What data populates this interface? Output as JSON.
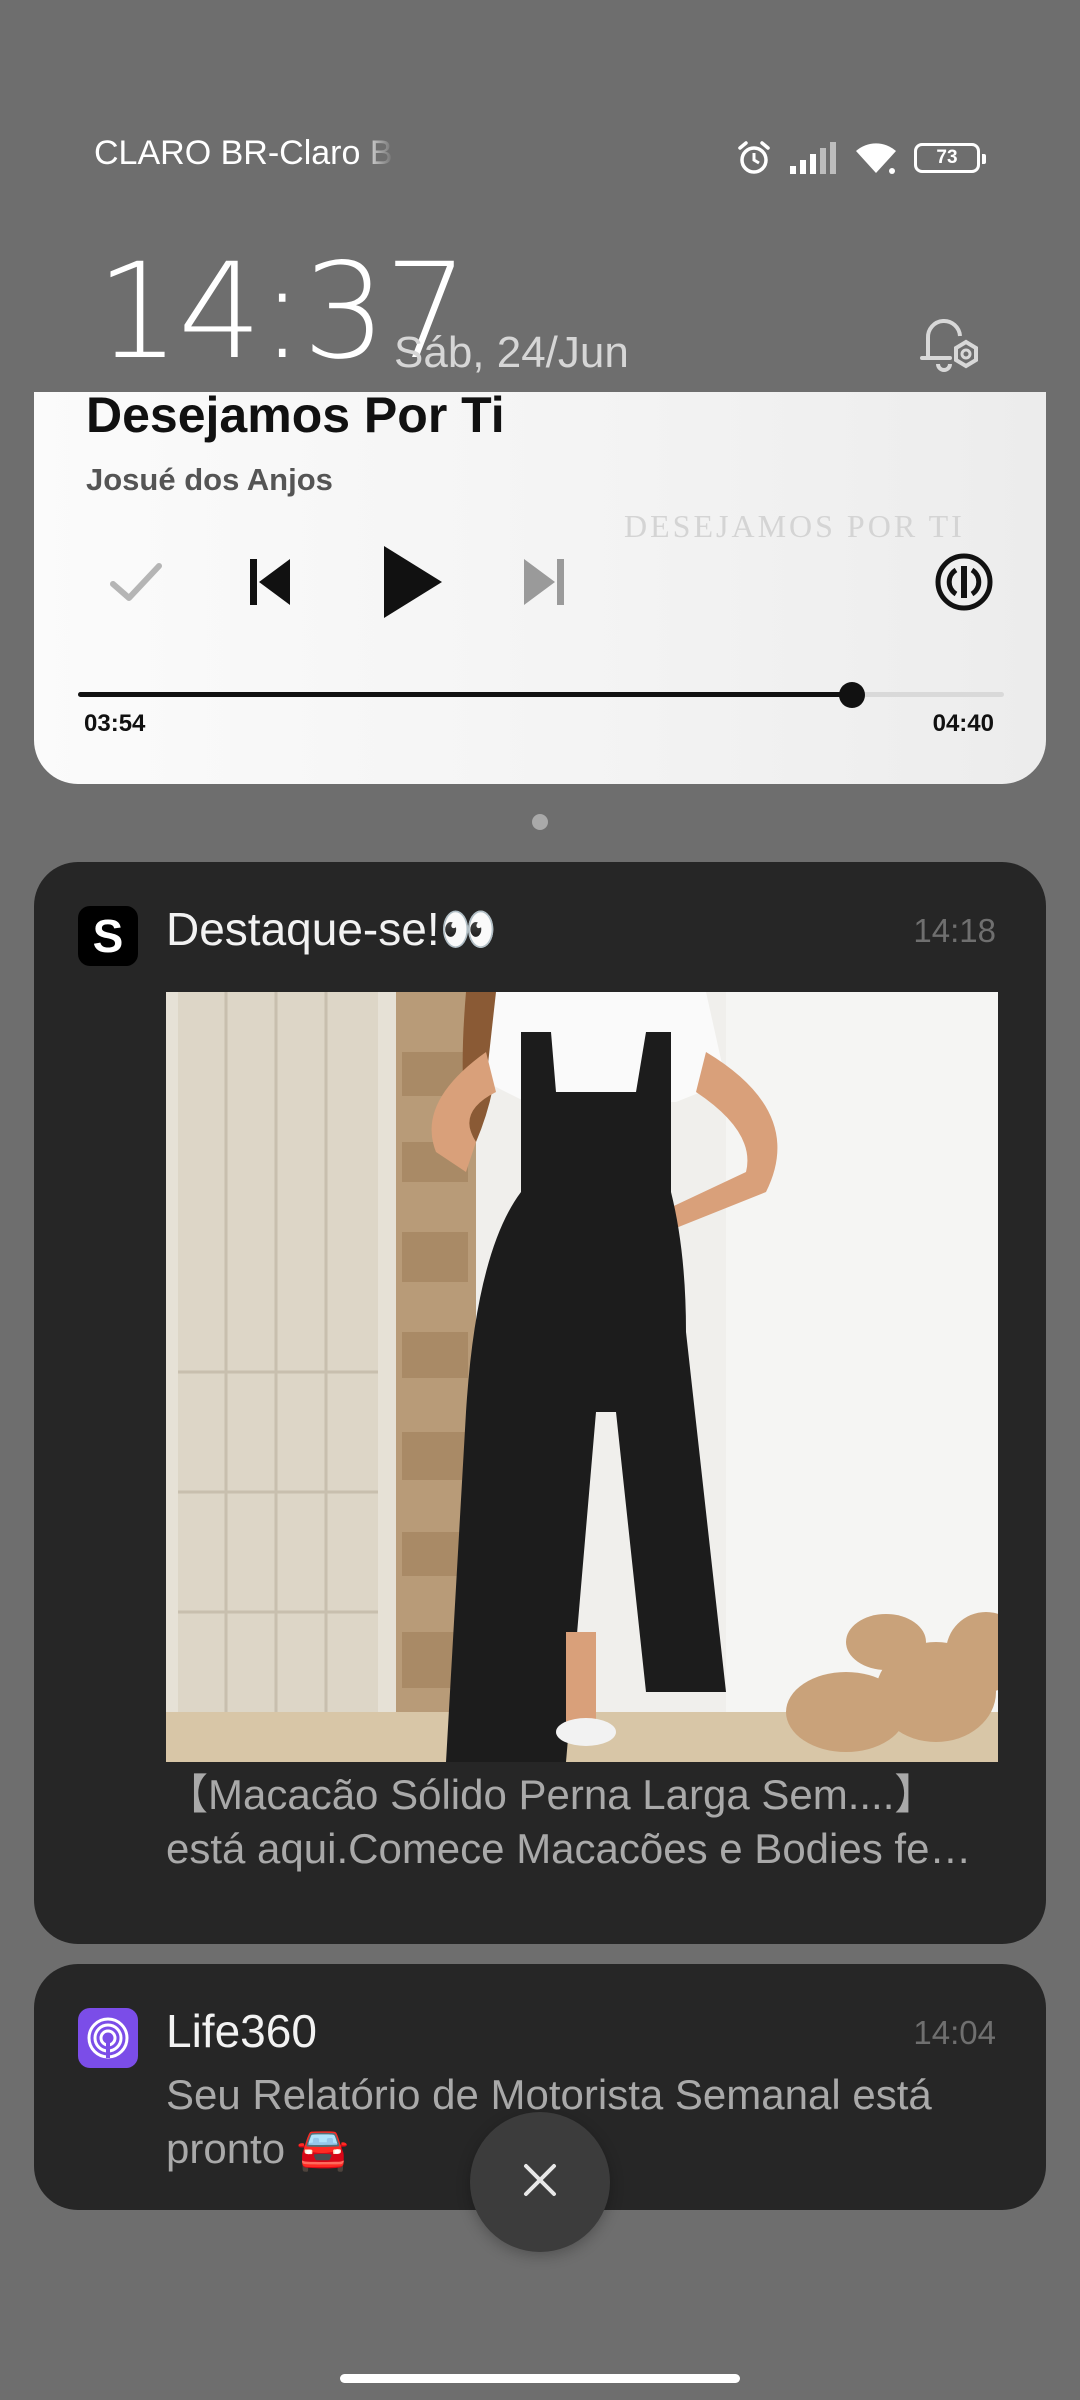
{
  "status_bar": {
    "carrier": "CLARO BR-Claro BR",
    "battery": "73",
    "icons": [
      "alarm-icon",
      "signal-icon",
      "wifi-icon",
      "battery-icon"
    ]
  },
  "header": {
    "time": "14:37",
    "date": "Sáb, 24/Jun",
    "settings_icon": "notification-settings-icon"
  },
  "media": {
    "title": "Desejamos Por Ti",
    "artist": "Josué dos Anjos",
    "art_text": "DESEJAMOS POR TI",
    "elapsed": "03:54",
    "total": "04:40",
    "progress": 0.836,
    "controls": [
      "check-icon",
      "previous-track-icon",
      "play-icon",
      "next-track-icon",
      "cast-icon"
    ]
  },
  "notifications": [
    {
      "app_icon": "shein-icon",
      "app_letter": "S",
      "title": "Destaque-se!👀",
      "time": "14:18",
      "body_line_1": "【Macacão Sólido Perna Larga Sem....】",
      "body_line_2": "está aqui.Comece Macacões e Bodies fe…"
    },
    {
      "app_icon": "life360-icon",
      "title": "Life360",
      "time": "14:04",
      "body_line_1": "Seu Relatório de Motorista Semanal está",
      "body_line_2": "pronto 🚘"
    }
  ],
  "dismiss": {
    "icon": "close-icon"
  },
  "colors": {
    "background": "#6e6e6e",
    "card": "#262626",
    "media_card": "#f6f6f6",
    "life360_purple": "#7b4de8"
  }
}
